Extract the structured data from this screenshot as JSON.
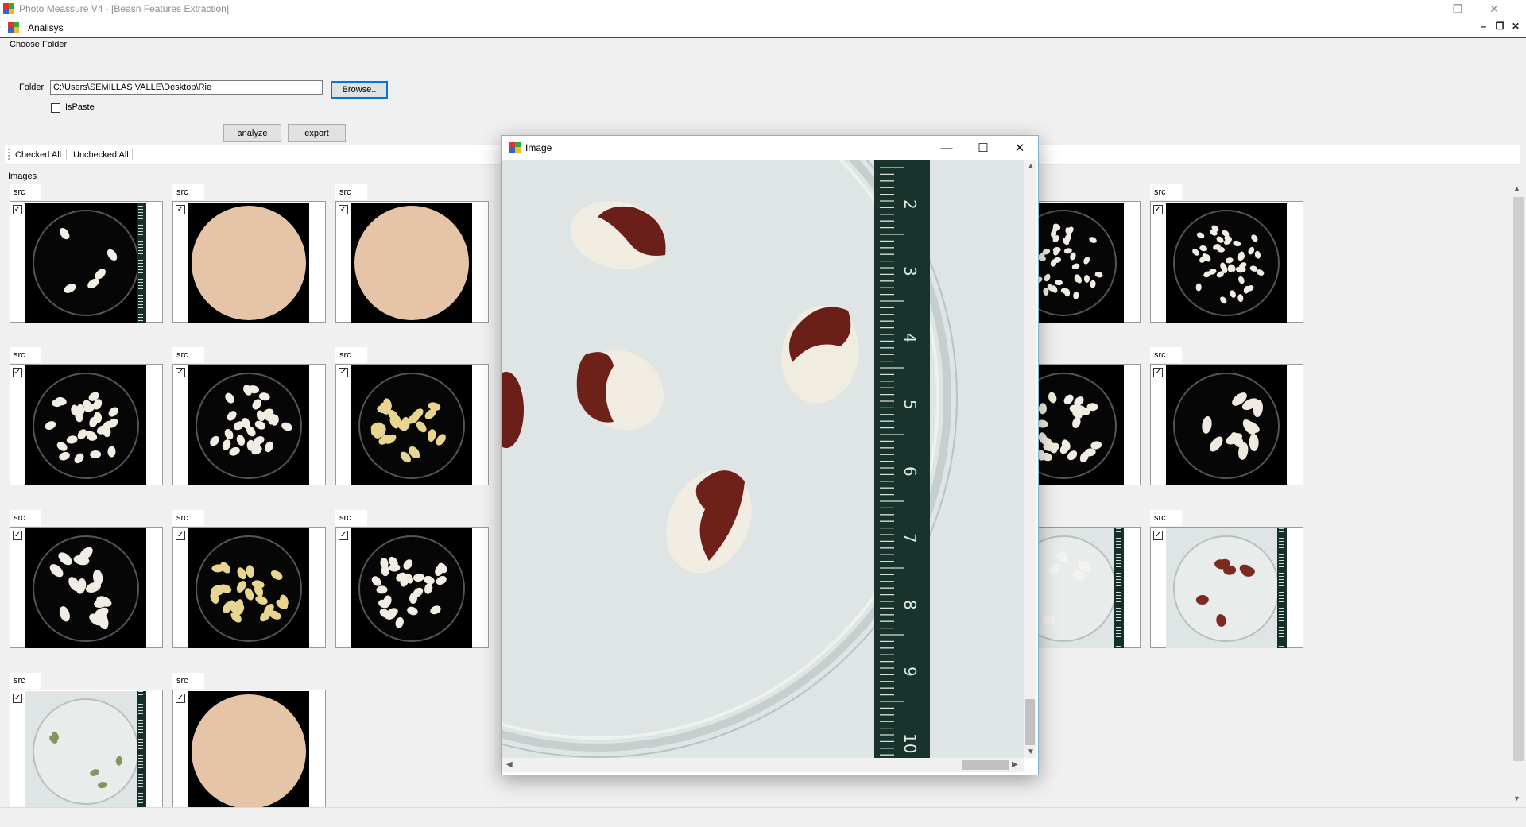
{
  "window": {
    "title": "Photo Meassure V4 - [Beasn Features Extraction]",
    "minimize": "—",
    "maximize": "❐",
    "close": "✕"
  },
  "child": {
    "title": "Analisys",
    "minimize": "–",
    "restore": "❐",
    "close": "✕"
  },
  "choose_folder": {
    "group_label": "Choose Folder",
    "folder_label": "Folder",
    "folder_value": "C:\\Users\\SEMILLAS VALLE\\Desktop\\Rie",
    "browse_label": "Browse..",
    "ispaste_label": "IsPaste",
    "ispaste_checked": false,
    "analyze_label": "analyze",
    "export_label": "export"
  },
  "toolstrip": {
    "checked_all": "Checked All",
    "unchecked_all": "Unchecked All"
  },
  "images": {
    "label": "Images",
    "tab_label": "src",
    "thumbnails": [
      {
        "style": "dark-few-white",
        "checked": true
      },
      {
        "style": "tan",
        "checked": true
      },
      {
        "style": "tan",
        "checked": true
      },
      {
        "style": "tan",
        "checked": true
      },
      {
        "style": "dark-many-small",
        "checked": true
      },
      {
        "style": "dark-many-small",
        "checked": true
      },
      {
        "style": "dark-many-white",
        "checked": true
      },
      {
        "style": "dark-many-white",
        "checked": true
      },
      {
        "style": "dark-many-yellow",
        "checked": true
      },
      {
        "style": "dark-many-white",
        "checked": true
      },
      {
        "style": "dark-many-white",
        "checked": true
      },
      {
        "style": "dark-few-large",
        "checked": true
      },
      {
        "style": "dark-many-large",
        "checked": true
      },
      {
        "style": "dark-many-yellow",
        "checked": true
      },
      {
        "style": "dark-many-white",
        "checked": true
      },
      {
        "style": "light-green",
        "checked": true
      },
      {
        "style": "light-white",
        "checked": true
      },
      {
        "style": "light-red",
        "checked": true
      },
      {
        "style": "light-green",
        "checked": true
      },
      {
        "style": "tan",
        "checked": true
      }
    ]
  },
  "image_window": {
    "title": "Image",
    "minimize": "—",
    "maximize": "☐",
    "close": "✕",
    "ruler_numbers": [
      "2",
      "3",
      "4",
      "5",
      "6",
      "7",
      "8",
      "9",
      "10"
    ]
  }
}
